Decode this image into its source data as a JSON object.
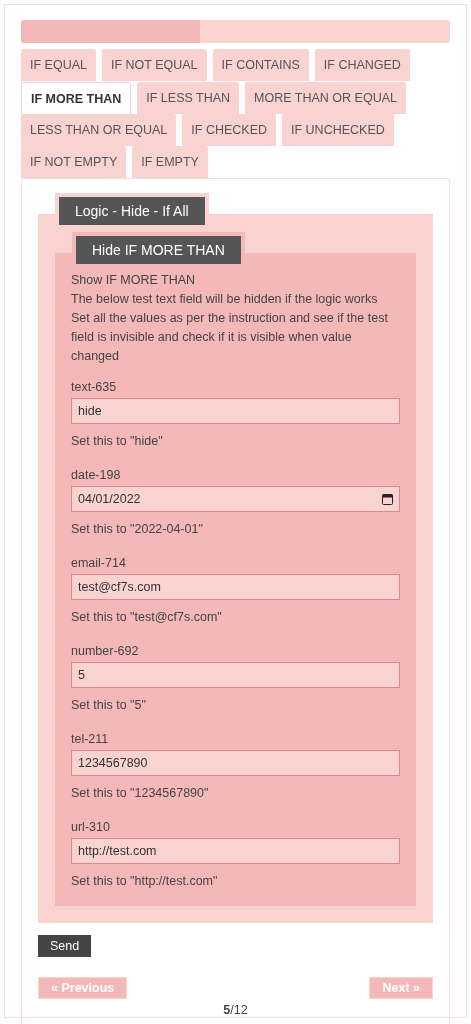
{
  "progress": {
    "level": 0.417
  },
  "tabs": [
    {
      "label": "IF EQUAL",
      "selected": false
    },
    {
      "label": "IF NOT EQUAL",
      "selected": false
    },
    {
      "label": "IF CONTAINS",
      "selected": false
    },
    {
      "label": "IF CHANGED",
      "selected": false
    },
    {
      "label": "IF MORE THAN",
      "selected": true
    },
    {
      "label": "IF LESS THAN",
      "selected": false
    },
    {
      "label": "MORE THAN OR EQUAL",
      "selected": false
    },
    {
      "label": "LESS THAN OR EQUAL",
      "selected": false
    },
    {
      "label": "IF CHECKED",
      "selected": false
    },
    {
      "label": "IF UNCHECKED",
      "selected": false
    },
    {
      "label": "IF NOT EMPTY",
      "selected": false
    },
    {
      "label": "IF EMPTY",
      "selected": false
    }
  ],
  "outer_group": {
    "legend": "Logic - Hide - If All"
  },
  "inner_group": {
    "legend": "Hide IF MORE THAN",
    "intro": [
      "Show IF MORE THAN",
      "The below test text field will be hidden if the logic works",
      "Set all the values as per the instruction and see if the test field is invisible and check if it is visible when value changed"
    ],
    "fields": [
      {
        "label": "text-635",
        "kind": "text",
        "value": "hide",
        "hint": "Set this to \"hide\""
      },
      {
        "label": "date-198",
        "kind": "date",
        "value": "04/01/2022",
        "hint": "Set this to \"2022-04-01\""
      },
      {
        "label": "email-714",
        "kind": "text",
        "value": "test@cf7s.com",
        "hint": "Set this to \"test@cf7s.com\""
      },
      {
        "label": "number-692",
        "kind": "text",
        "value": "5",
        "hint": "Set this to \"5\""
      },
      {
        "label": "tel-211",
        "kind": "text",
        "value": "1234567890",
        "hint": "Set this to \"1234567890\""
      },
      {
        "label": "url-310",
        "kind": "text",
        "value": "http://test.com",
        "hint": "Set this to \"http://test.com\""
      }
    ]
  },
  "send_button": "Send",
  "previous_button": "« Previous",
  "next_button": "Next »",
  "page_counter": "**5**/12"
}
